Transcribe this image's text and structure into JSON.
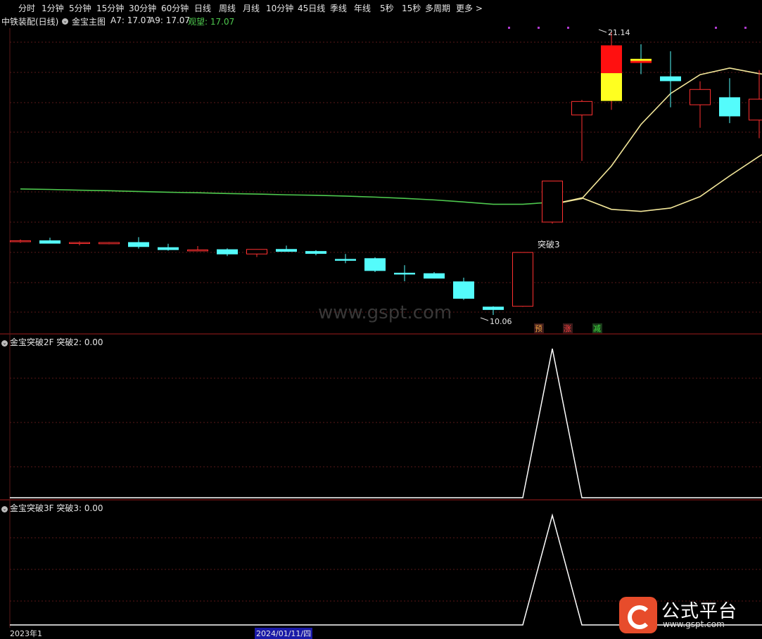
{
  "toolbar": {
    "periods": [
      "分时",
      "1分钟",
      "5分钟",
      "15分钟",
      "30分钟",
      "60分钟",
      "日线",
      "周线",
      "月线",
      "10分钟",
      "45日线",
      "季线",
      "年线",
      "5秒",
      "15秒",
      "多周期",
      "更多 >"
    ]
  },
  "main_panel": {
    "stock_name": "中铁装配(日线)",
    "indicator_name": "金宝主图",
    "a7": "A7: 17.07",
    "a9": "A9: 17.07",
    "watch": "观望: 17.07",
    "high_label": "21.14",
    "low_label": "10.06",
    "breakout_label": "突破3",
    "signal_1": "预",
    "signal_2": "涨",
    "signal_3": "减"
  },
  "panel2": {
    "title": "金宝突破2F  突破2: 0.00"
  },
  "panel3": {
    "title": "金宝突破3F  突破3: 0.00"
  },
  "axis": {
    "left_label": "2023年1",
    "date_label": "2024/01/11/四"
  },
  "watermark": "www.gspt.com",
  "brand": {
    "name": "公式平台",
    "url": "www.gspt.com"
  },
  "colors": {
    "up": "#ff3030",
    "down": "#54fcfc",
    "ma_green": "#4ec94e",
    "ma_yellow": "#f3e79a",
    "signal_white": "#ffffff",
    "grid": "#5a1818",
    "sep": "#a01c1c"
  },
  "chart_data": {
    "type": "candlestick",
    "candles": [
      {
        "o": 12.95,
        "h": 13.02,
        "l": 12.89,
        "c": 12.97
      },
      {
        "o": 12.97,
        "h": 13.09,
        "l": 12.88,
        "c": 12.87
      },
      {
        "o": 12.87,
        "h": 12.94,
        "l": 12.79,
        "c": 12.9
      },
      {
        "o": 12.85,
        "h": 12.92,
        "l": 12.83,
        "c": 12.9
      },
      {
        "o": 12.9,
        "h": 13.11,
        "l": 12.66,
        "c": 12.74
      },
      {
        "o": 12.7,
        "h": 12.85,
        "l": 12.58,
        "c": 12.62
      },
      {
        "o": 12.59,
        "h": 12.76,
        "l": 12.55,
        "c": 12.61
      },
      {
        "o": 12.62,
        "h": 12.67,
        "l": 12.37,
        "c": 12.45
      },
      {
        "o": 12.45,
        "h": 12.64,
        "l": 12.33,
        "c": 12.63
      },
      {
        "o": 12.63,
        "h": 12.78,
        "l": 12.54,
        "c": 12.55
      },
      {
        "o": 12.55,
        "h": 12.6,
        "l": 12.4,
        "c": 12.47
      },
      {
        "o": 12.24,
        "h": 12.45,
        "l": 12.09,
        "c": 12.23
      },
      {
        "o": 12.27,
        "h": 12.32,
        "l": 11.74,
        "c": 11.8
      },
      {
        "o": 11.7,
        "h": 12.01,
        "l": 11.38,
        "c": 11.66
      },
      {
        "o": 11.68,
        "h": 11.74,
        "l": 11.49,
        "c": 11.5
      },
      {
        "o": 11.36,
        "h": 11.52,
        "l": 10.65,
        "c": 10.71
      },
      {
        "o": 10.37,
        "h": 10.4,
        "l": 10.06,
        "c": 10.27
      },
      {
        "o": 10.4,
        "h": 12.51,
        "l": 10.38,
        "c": 12.51
      },
      {
        "o": 13.7,
        "h": 15.31,
        "l": 13.64,
        "c": 15.31
      },
      {
        "o": 17.9,
        "h": 18.49,
        "l": 16.1,
        "c": 18.43
      },
      {
        "o": 18.45,
        "h": 21.14,
        "l": 18.1,
        "c": 20.63
      },
      {
        "o": 20.1,
        "h": 20.67,
        "l": 19.5,
        "c": 19.94
      },
      {
        "o": 19.4,
        "h": 20.4,
        "l": 18.2,
        "c": 19.24
      },
      {
        "o": 18.3,
        "h": 19.22,
        "l": 17.4,
        "c": 18.9
      },
      {
        "o": 18.58,
        "h": 19.34,
        "l": 17.58,
        "c": 17.86
      },
      {
        "o": 17.7,
        "h": 19.66,
        "l": 16.99,
        "c": 18.52
      }
    ],
    "ma_green": [
      15.0,
      14.98,
      14.95,
      14.93,
      14.9,
      14.87,
      14.85,
      14.82,
      14.8,
      14.77,
      14.75,
      14.72,
      14.68,
      14.63,
      14.57,
      14.49,
      14.4,
      14.4,
      14.48
    ],
    "ma_yellow_fast": [
      14.4,
      14.62,
      15.9,
      17.53,
      18.74,
      19.48,
      19.74,
      19.52,
      19.37,
      19.1
    ],
    "ma_yellow_slow": [
      14.4,
      14.65,
      14.2,
      14.12,
      14.25,
      14.7,
      15.51,
      16.28,
      16.94,
      17.4
    ],
    "signal_days_index": [
      18
    ],
    "panel2_values": [
      0,
      0,
      0,
      0,
      0,
      0,
      0,
      0,
      0,
      0,
      0,
      0,
      0,
      0,
      0,
      0,
      0,
      0,
      1,
      0,
      0,
      0,
      0,
      0,
      0,
      0
    ],
    "panel3_values": [
      0,
      0,
      0,
      0,
      0,
      0,
      0,
      0,
      0,
      0,
      0,
      0,
      0,
      0,
      0,
      0,
      0,
      0,
      1,
      0,
      0,
      0,
      0,
      0,
      0,
      0
    ]
  }
}
